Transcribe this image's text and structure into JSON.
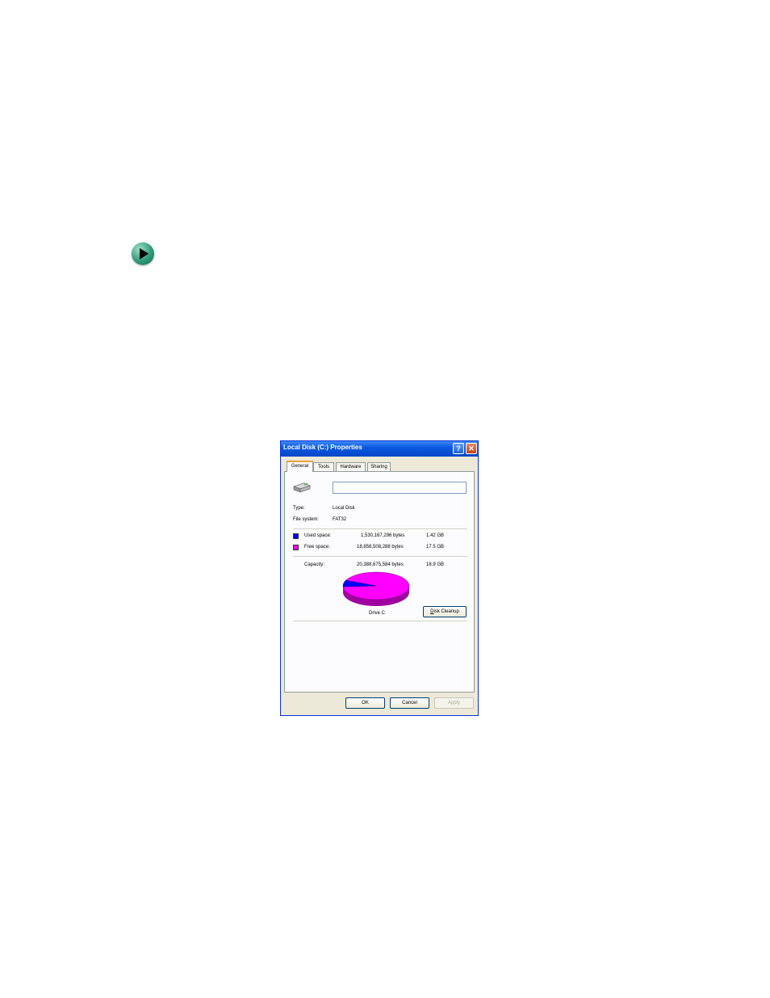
{
  "dialog": {
    "title": "Local Disk (C:) Properties",
    "help_glyph": "?",
    "close_glyph": "✕"
  },
  "tabs": [
    {
      "label": "General"
    },
    {
      "label": "Tools"
    },
    {
      "label": "Hardware"
    },
    {
      "label": "Sharing"
    }
  ],
  "general": {
    "name_value": "",
    "type_label": "Type:",
    "type_value": "Local Disk",
    "fs_label": "File system:",
    "fs_value": "FAT32",
    "used": {
      "label": "Used space:",
      "bytes": "1,530,167,296 bytes",
      "size": "1.42 GB",
      "color": "#0000ff"
    },
    "free": {
      "label": "Free space:",
      "bytes": "18,858,508,288 bytes",
      "size": "17.5 GB",
      "color": "#ff00ff"
    },
    "capacity": {
      "label": "Capacity:",
      "bytes": "20,388,675,584 bytes",
      "size": "18.9 GB"
    },
    "drive_label": "Drive C",
    "cleanup_label_first": "D",
    "cleanup_label_rest": "isk Cleanup",
    "used_fraction": 0.075
  },
  "buttons": {
    "ok": "OK",
    "cancel": "Cancel",
    "apply": "Apply"
  },
  "icons": {
    "arrow": "arrow-right-icon",
    "drive": "hard-drive-icon"
  }
}
